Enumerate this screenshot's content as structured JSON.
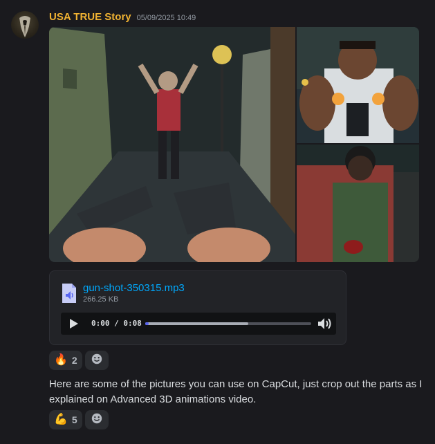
{
  "author": {
    "username": "USA TRUE Story",
    "timestamp": "05/09/2025 10:49",
    "username_color": "#f0b232"
  },
  "attachments": {
    "images": [
      {
        "name": "alley-gunpoint-illustration"
      },
      {
        "name": "gunman-aiming-illustration"
      },
      {
        "name": "wounded-man-illustration"
      }
    ],
    "audio": {
      "file_name": "gun-shot-350315.mp3",
      "file_size": "266.25 KB",
      "current_time": "0:00",
      "separator": "/",
      "duration": "0:08",
      "played_fraction": 0.0,
      "buffered_fraction": 0.62,
      "accent_color": "#5865f2",
      "link_color": "#00a8fc"
    }
  },
  "reactions_1": [
    {
      "emoji": "🔥",
      "count": "2"
    }
  ],
  "message": {
    "text": "Here are some of the pictures you can use on CapCut, just crop out the parts as I explained on Advanced 3D animations video."
  },
  "reactions_2": [
    {
      "emoji": "💪",
      "count": "5"
    }
  ],
  "icons": {
    "add_reaction": "smile-add-icon",
    "file": "audio-file-icon",
    "play": "play-icon",
    "volume": "volume-icon"
  }
}
